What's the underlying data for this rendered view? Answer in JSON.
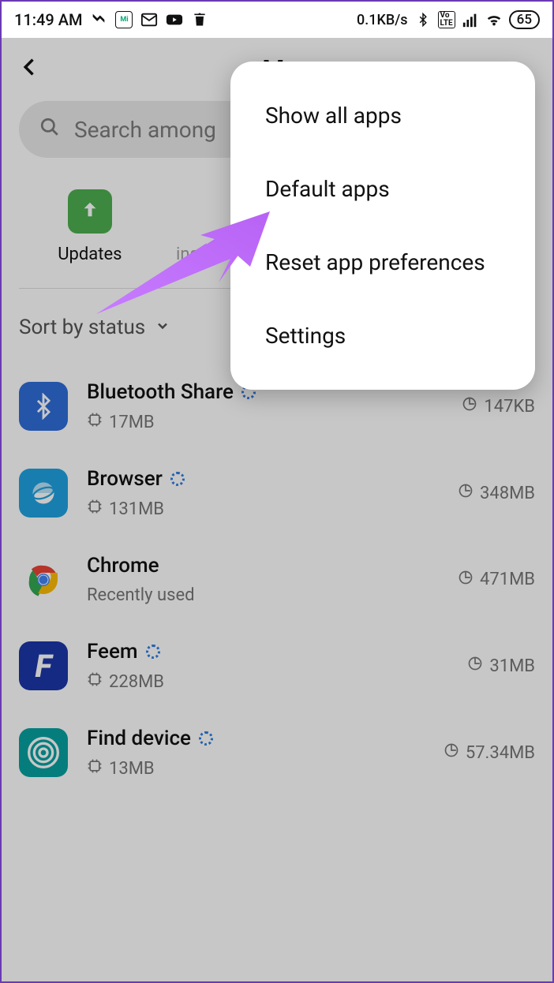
{
  "status": {
    "time": "11:49 AM",
    "speed": "0.1KB/s",
    "battery": "65",
    "icons": {
      "credit": "Mi Credit"
    }
  },
  "header": {
    "title": "Ma"
  },
  "search": {
    "placeholder": "Search among"
  },
  "tabs": {
    "updates": "Updates",
    "uninstall": "inst"
  },
  "sort": {
    "label": "Sort by status"
  },
  "apps": [
    {
      "name": "Bluetooth Share",
      "storage": "17MB",
      "data": "147KB",
      "running": true,
      "icon": "bluetooth",
      "bg": "#2f6ed9"
    },
    {
      "name": "Browser",
      "storage": "131MB",
      "data": "348MB",
      "running": true,
      "icon": "browser",
      "bg": "#1fa2e0"
    },
    {
      "name": "Chrome",
      "subtitle": "Recently used",
      "data": "471MB",
      "running": false,
      "icon": "chrome",
      "bg": "#ffffff"
    },
    {
      "name": "Feem",
      "storage": "228MB",
      "data": "31MB",
      "running": true,
      "icon": "feem",
      "bg": "#1b37a8"
    },
    {
      "name": "Find device",
      "storage": "13MB",
      "data": "57.34MB",
      "running": true,
      "icon": "find",
      "bg": "#07a0a0"
    }
  ],
  "menu": {
    "items": [
      "Show all apps",
      "Default apps",
      "Reset app preferences",
      "Settings"
    ]
  }
}
